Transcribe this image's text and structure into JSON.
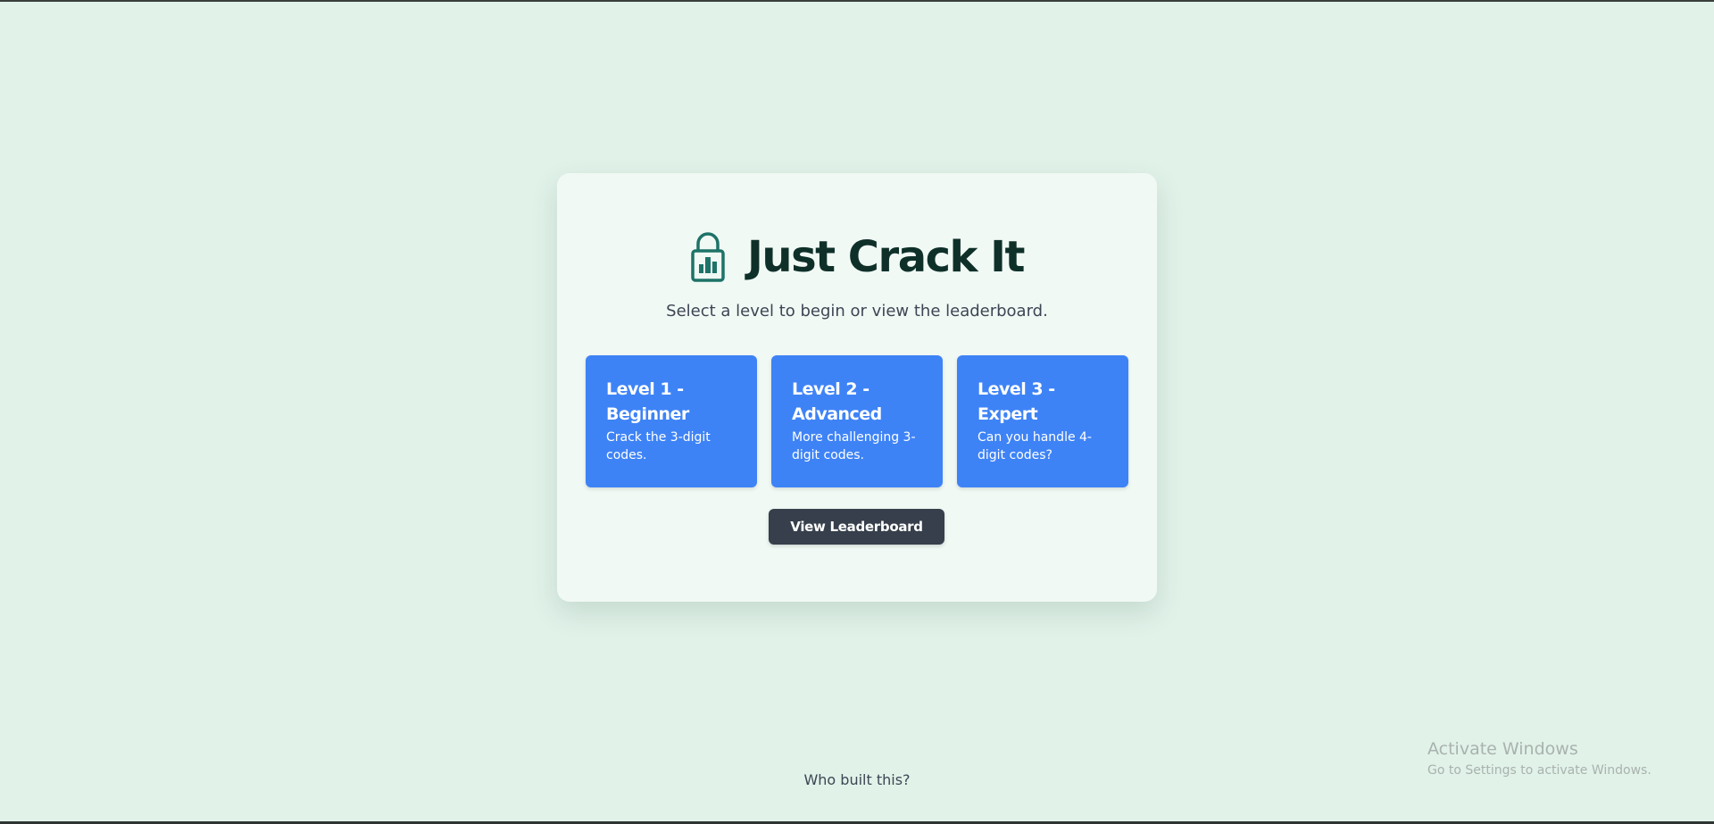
{
  "app": {
    "title": "Just Crack It",
    "subtitle": "Select a level to begin or view the leaderboard.",
    "logo_icon": "lock-icon",
    "colors": {
      "background": "#e1f2e9",
      "card": "#f1f9f5",
      "title": "#0e3029",
      "icon": "#1d7367",
      "level_button": "#3e83f6",
      "leaderboard_button": "#363f4b"
    }
  },
  "levels": [
    {
      "title": "Level 1 - Beginner",
      "description": "Crack the 3-digit codes."
    },
    {
      "title": "Level 2 - Advanced",
      "description": "More challenging 3-digit codes."
    },
    {
      "title": "Level 3 - Expert",
      "description": "Can you handle 4-digit codes?"
    }
  ],
  "leaderboard_button": "View Leaderboard",
  "footer": {
    "link": "Who built this?"
  },
  "watermark": {
    "title": "Activate Windows",
    "subtitle": "Go to Settings to activate Windows."
  }
}
